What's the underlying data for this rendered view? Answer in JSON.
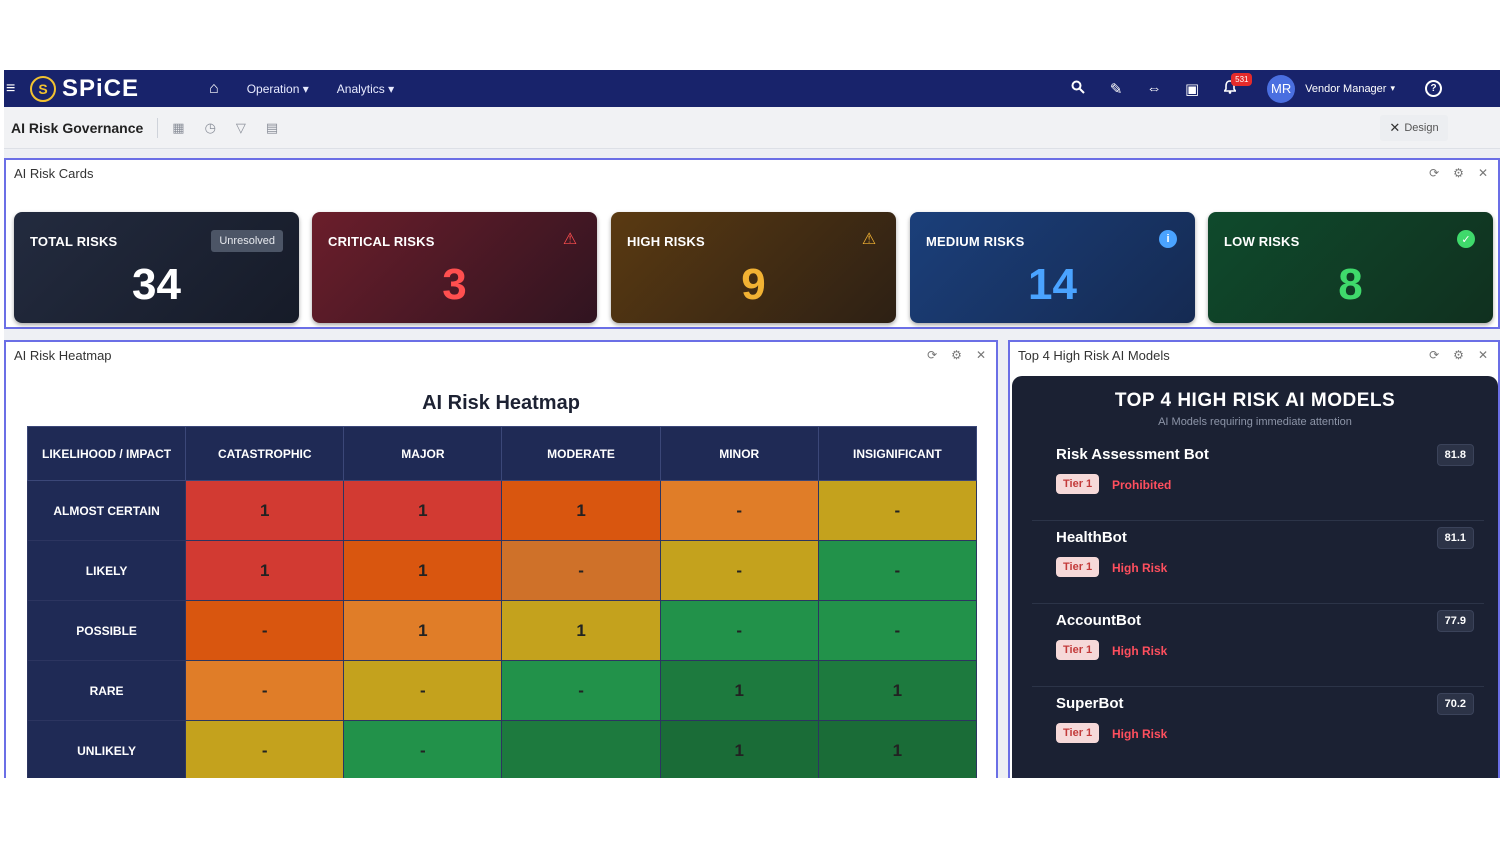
{
  "nav": {
    "brand": "SPiCE",
    "menu": [
      {
        "label": "Operation"
      },
      {
        "label": "Analytics"
      }
    ],
    "notification_count": "531",
    "user_initials": "MR",
    "user_name": "Vendor Manager"
  },
  "toolbar": {
    "page_title": "AI Risk Governance",
    "design_label": "Design"
  },
  "cards_panel": {
    "title": "AI Risk Cards",
    "cards": [
      {
        "label": "TOTAL RISKS",
        "value": "34",
        "badge": "Unresolved"
      },
      {
        "label": "CRITICAL RISKS",
        "value": "3"
      },
      {
        "label": "HIGH RISKS",
        "value": "9"
      },
      {
        "label": "MEDIUM RISKS",
        "value": "14"
      },
      {
        "label": "LOW RISKS",
        "value": "8"
      }
    ]
  },
  "heatmap": {
    "panel_title": "AI Risk Heatmap",
    "heading": "AI Risk Heatmap",
    "corner_header": "LIKELIHOOD / IMPACT",
    "columns": [
      "CATASTROPHIC",
      "MAJOR",
      "MODERATE",
      "MINOR",
      "INSIGNIFICANT"
    ],
    "rows": [
      {
        "label": "ALMOST CERTAIN",
        "cells": [
          "1",
          "1",
          "1",
          "-",
          "-"
        ]
      },
      {
        "label": "LIKELY",
        "cells": [
          "1",
          "1",
          "-",
          "-",
          "-"
        ]
      },
      {
        "label": "POSSIBLE",
        "cells": [
          "-",
          "1",
          "1",
          "-",
          "-"
        ]
      },
      {
        "label": "RARE",
        "cells": [
          "-",
          "-",
          "-",
          "1",
          "1"
        ]
      },
      {
        "label": "UNLIKELY",
        "cells": [
          "-",
          "-",
          "",
          "1",
          "1"
        ]
      }
    ],
    "cell_colors": [
      [
        "#d23a32",
        "#d23a32",
        "#d9560f",
        "#e07d28",
        "#c4a21d"
      ],
      [
        "#d23a32",
        "#d9560f",
        "#cf7129",
        "#c4a21d",
        "#22924a"
      ],
      [
        "#d9560f",
        "#e07d28",
        "#c4a21d",
        "#22924a",
        "#22924a"
      ],
      [
        "#e07d28",
        "#c4a21d",
        "#22924a",
        "#1d7a3e",
        "#1d7a3e"
      ],
      [
        "#c4a21d",
        "#22924a",
        "#1d7a3e",
        "#1a6c37",
        "#1a6c37"
      ]
    ]
  },
  "models": {
    "panel_title": "Top 4 High Risk AI Models",
    "heading": "TOP 4 HIGH RISK AI MODELS",
    "subtitle": "AI Models requiring immediate attention",
    "items": [
      {
        "name": "Risk Assessment Bot",
        "score": "81.8",
        "tier": "Tier 1",
        "status": "Prohibited"
      },
      {
        "name": "HealthBot",
        "score": "81.1",
        "tier": "Tier 1",
        "status": "High Risk"
      },
      {
        "name": "AccountBot",
        "score": "77.9",
        "tier": "Tier 1",
        "status": "High Risk"
      },
      {
        "name": "SuperBot",
        "score": "70.2",
        "tier": "Tier 1",
        "status": "High Risk"
      }
    ]
  },
  "colors": {
    "nav_bg": "#18236b",
    "panel_border": "#6b6fe6",
    "critical": "#ff4f4f",
    "high": "#f2b233",
    "medium": "#4aa3ff",
    "low": "#3fd96b"
  }
}
